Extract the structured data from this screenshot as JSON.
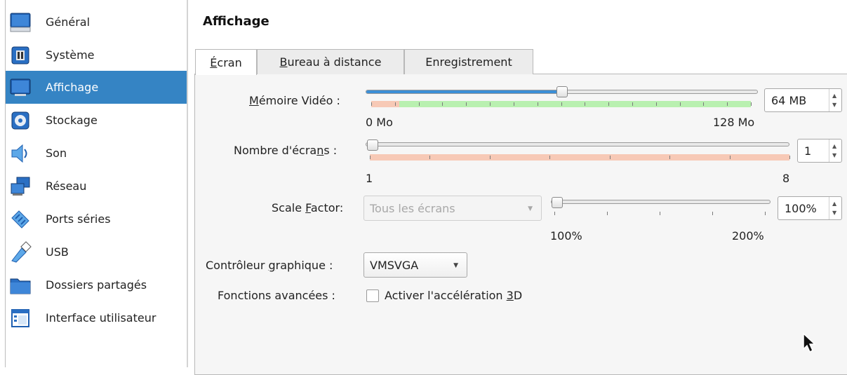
{
  "sidebar": {
    "items": [
      {
        "label": "Général",
        "icon": "general-icon",
        "selected": false
      },
      {
        "label": "Système",
        "icon": "system-icon",
        "selected": false
      },
      {
        "label": "Affichage",
        "icon": "display-icon",
        "selected": true
      },
      {
        "label": "Stockage",
        "icon": "storage-icon",
        "selected": false
      },
      {
        "label": "Son",
        "icon": "audio-icon",
        "selected": false
      },
      {
        "label": "Réseau",
        "icon": "network-icon",
        "selected": false
      },
      {
        "label": "Ports séries",
        "icon": "serial-ports-icon",
        "selected": false
      },
      {
        "label": "USB",
        "icon": "usb-icon",
        "selected": false
      },
      {
        "label": "Dossiers partagés",
        "icon": "shared-folders-icon",
        "selected": false
      },
      {
        "label": "Interface utilisateur",
        "icon": "user-interface-icon",
        "selected": false
      }
    ]
  },
  "page": {
    "title": "Affichage"
  },
  "tabs": [
    {
      "label_pre": "",
      "label_u": "É",
      "label_post": "cran",
      "active": true
    },
    {
      "label_pre": "",
      "label_u": "B",
      "label_post": "ureau à distance",
      "active": false
    },
    {
      "label_pre": "",
      "label_u": "",
      "label_post": "Enregistrement",
      "active": false
    }
  ],
  "video_memory": {
    "label_pre": "",
    "label_u": "M",
    "label_post": "émoire Vidéo :",
    "value": "64 MB",
    "min_label": "0 Mo",
    "max_label": "128 Mo",
    "slider_fraction": 0.5
  },
  "monitors": {
    "label_pre": "Nombre d'écra",
    "label_u": "n",
    "label_post": "s :",
    "value": "1",
    "min_label": "1",
    "max_label": "8",
    "slider_fraction": 0.0
  },
  "scale_factor": {
    "label_pre": "Scale ",
    "label_u": "F",
    "label_post": "actor:",
    "combo_value": "Tous les écrans",
    "value": "100%",
    "min_label": "100%",
    "max_label": "200%",
    "slider_fraction": 0.0
  },
  "graphics_controller": {
    "label_pre": "Contrôleur ",
    "label_u": "g",
    "label_post": "raphique :",
    "value": "VMSVGA"
  },
  "advanced": {
    "label": "Fonctions avancées :",
    "checkbox_pre": "Activer l'accélération ",
    "checkbox_u": "3",
    "checkbox_post": "D",
    "checked": false
  },
  "colors": {
    "selection": "#3584c4",
    "slider_fill": "#3c8fd6",
    "recommended": "#b9f0b0",
    "warning": "#f7c9b6"
  }
}
